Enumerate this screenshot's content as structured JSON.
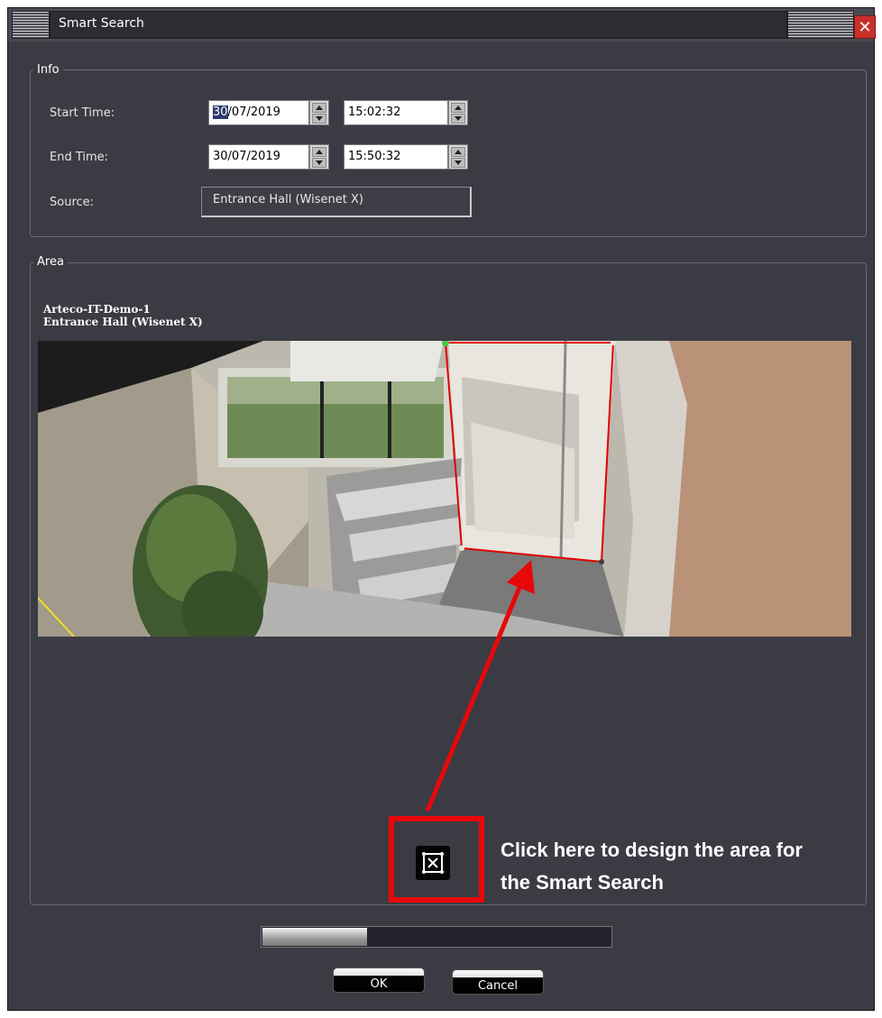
{
  "window": {
    "title": "Smart Search"
  },
  "info": {
    "legend": "Info",
    "start_time_label": "Start Time:",
    "start_date": "30/07/2019",
    "start_time": "15:02:32",
    "end_time_label": "End Time:",
    "end_date": "30/07/2019",
    "end_time": "15:50:32",
    "source_label": "Source:",
    "source_value": "Entrance Hall  (Wisenet X)"
  },
  "area": {
    "legend": "Area",
    "camera_server": "Arteco-IT-Demo-1",
    "camera_name": "Entrance Hall  (Wisenet X)"
  },
  "annotation": {
    "line1": "Click here to design the area for",
    "line2": "the Smart Search"
  },
  "progress": {
    "fraction": 0.3
  },
  "buttons": {
    "ok": "OK",
    "cancel": "Cancel"
  },
  "colors": {
    "accent": "#e8080a",
    "window_bg": "#3b3b44",
    "close": "#c8302a"
  },
  "icons": [
    "close-icon",
    "spin-up-icon",
    "spin-down-icon",
    "draw-area-icon"
  ]
}
